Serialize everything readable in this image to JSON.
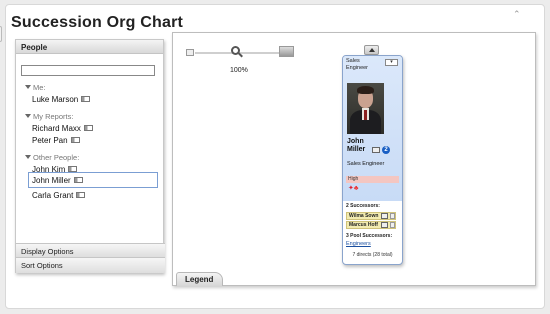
{
  "app": {
    "title": "Succession Org Chart",
    "collapse_glyph": "⌃"
  },
  "people_panel": {
    "header": "People",
    "search": {
      "value": "",
      "placeholder": ""
    },
    "groups": [
      {
        "label": "Me:",
        "people": [
          "Luke Marson"
        ]
      },
      {
        "label": "My Reports:",
        "people": [
          "Richard Maxx",
          "Peter Pan"
        ]
      },
      {
        "label": "Other People:",
        "people": [
          "John Kim",
          "John Miller",
          "Carla Grant"
        ]
      }
    ],
    "selected": "John Miller",
    "options": [
      "Display Options",
      "Sort Options"
    ]
  },
  "zoom": {
    "level": "100%"
  },
  "legend": {
    "label": "Legend"
  },
  "card": {
    "position_top": "Sales Engineer",
    "first_name": "John",
    "last_name": "Miller",
    "direct_count": "2",
    "position": "Sales Engineer",
    "risk_label": "High",
    "successors_label": "2 Successors:",
    "successors": [
      "Wilma Sown",
      "Marcus Hoff"
    ],
    "pool_label": "3 Pool Successors:",
    "pool_link": "Engineers",
    "footer": "7 directs   (28 total)"
  },
  "colors": {
    "card_header": "#c8dbf6",
    "risk_high": "#f4c6c1",
    "successor": "#f2ebb0",
    "count_badge": "#1a5fc4"
  }
}
